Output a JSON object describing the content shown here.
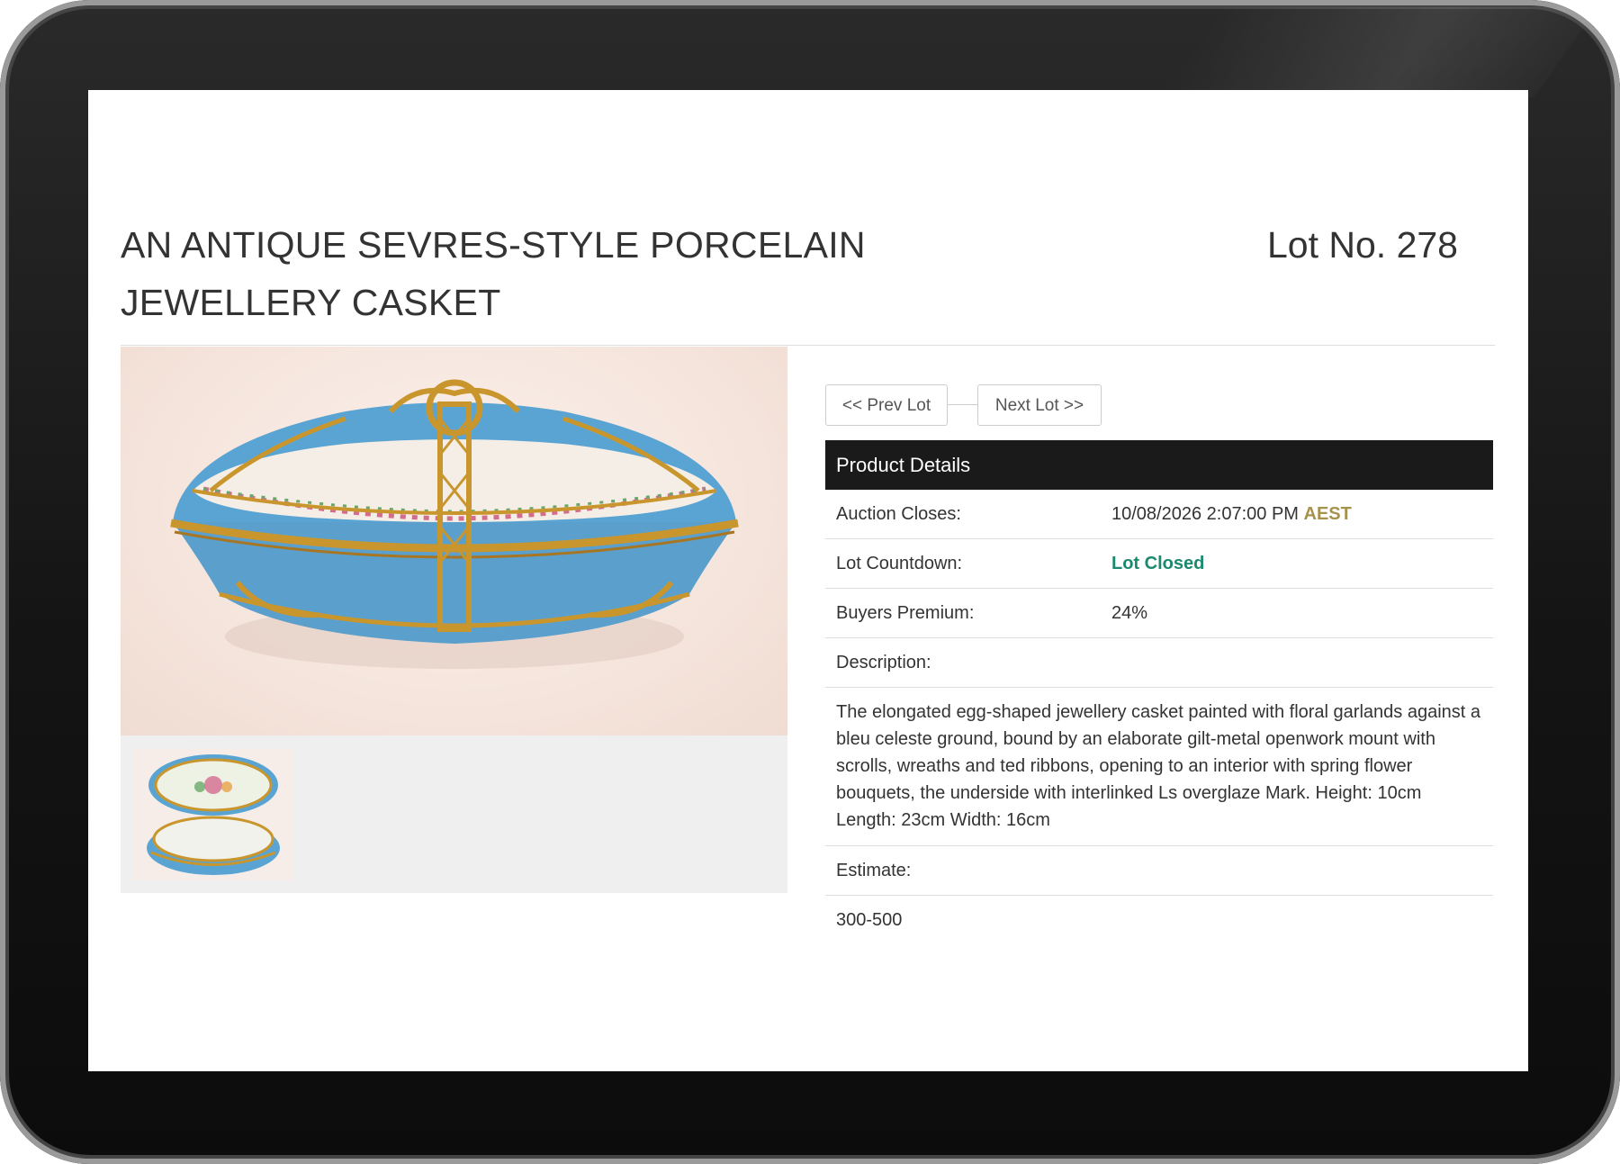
{
  "lot": {
    "title": "AN ANTIQUE SEVRES-STYLE PORCELAIN JEWELLERY CASKET",
    "number_label": "Lot No. 278"
  },
  "navigation": {
    "prev_label": "<< Prev Lot",
    "next_label": "Next Lot >>"
  },
  "details": {
    "header": "Product Details",
    "auction_closes_label": "Auction Closes:",
    "auction_closes_value": "10/08/2026 2:07:00 PM",
    "auction_closes_tz": "AEST",
    "countdown_label": "Lot Countdown:",
    "countdown_value": "Lot Closed",
    "premium_label": "Buyers Premium:",
    "premium_value": "24%",
    "description_label": "Description:",
    "description_text": "The elongated egg-shaped jewellery casket painted with floral garlands against a bleu celeste ground, bound by an elaborate gilt-metal openwork mount with scrolls, wreaths and ted ribbons, opening to an interior with spring flower bouquets, the underside with interlinked Ls overglaze Mark. Height: 10cm Length: 23cm Width: 16cm",
    "estimate_label": "Estimate:",
    "estimate_value": "300-500"
  },
  "colors": {
    "header_bg": "#1a1a1a",
    "timezone": "#a5924c",
    "status_closed": "#1a8a6e",
    "porcelain_blue": "#5aa4d4",
    "gilt": "#c9962e"
  },
  "gallery": {
    "main_image_icon": "porcelain-casket-photo",
    "thumbnail_icon": "open-casket-photo"
  }
}
